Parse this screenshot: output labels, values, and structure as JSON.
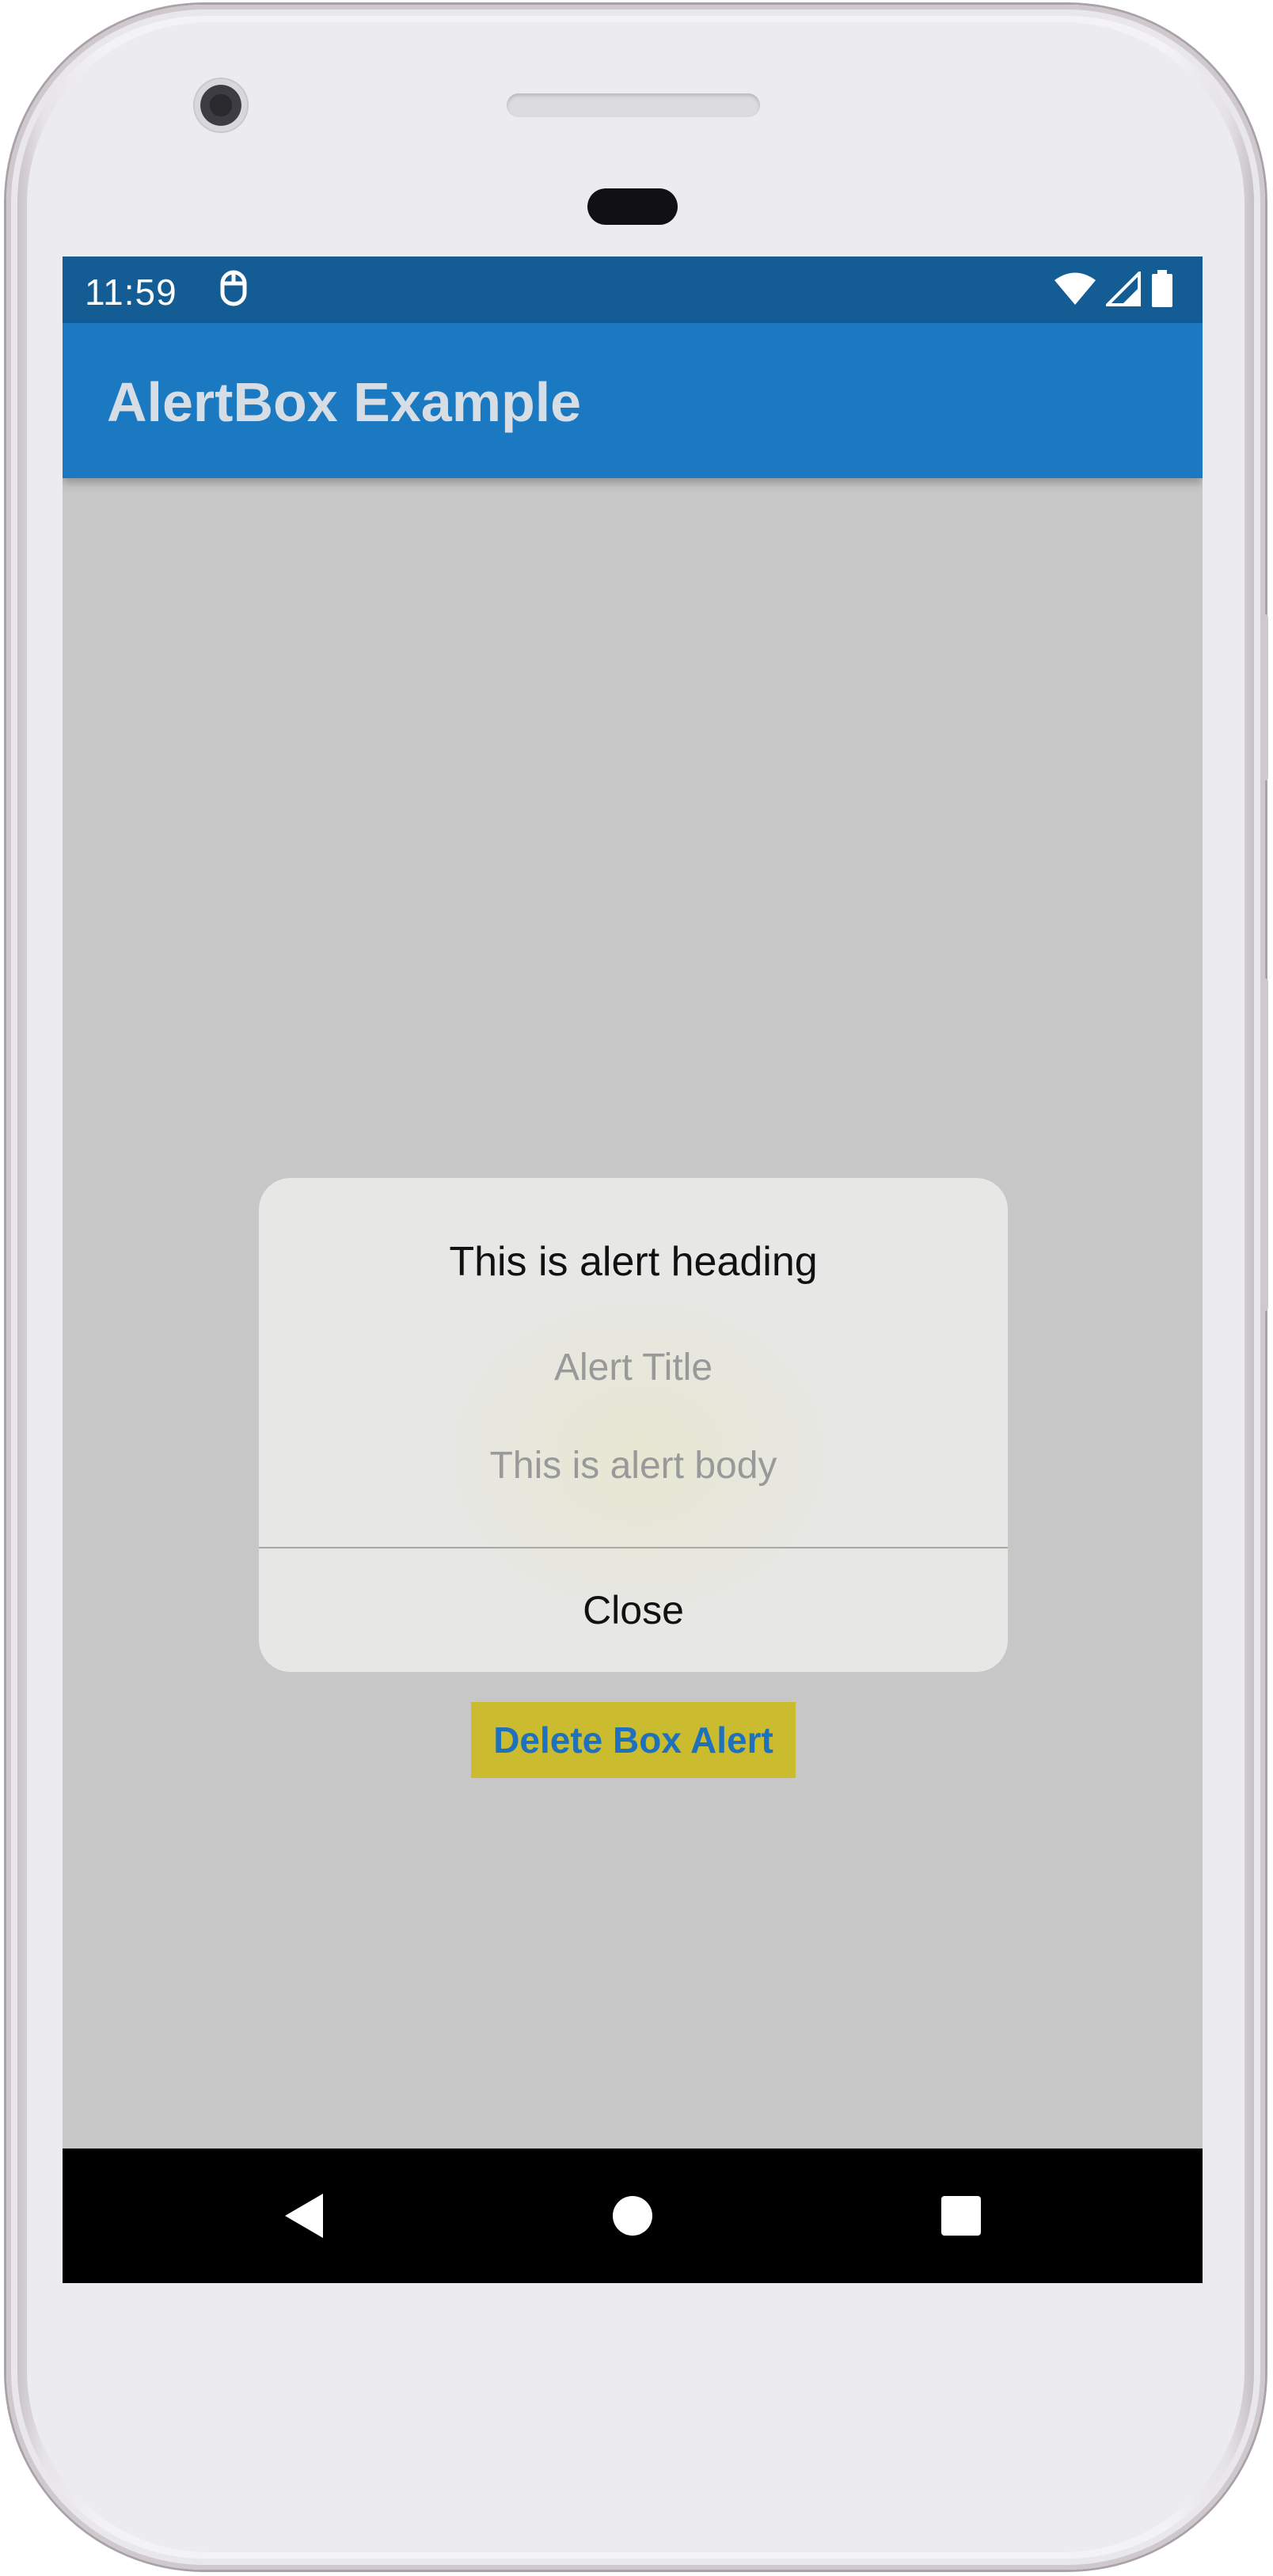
{
  "status_bar": {
    "time": "11:59",
    "icons": [
      "notification-app-icon",
      "wifi-icon",
      "signal-icon",
      "battery-icon"
    ]
  },
  "app_bar": {
    "title": "AlertBox Example"
  },
  "main": {
    "delete_button_label": "Delete Box Alert"
  },
  "dialog": {
    "heading": "This is alert heading",
    "title": "Alert Title",
    "body": "This is alert body",
    "close_label": "Close"
  },
  "nav_bar": {
    "icons": [
      "back-icon",
      "home-icon",
      "recents-icon"
    ]
  },
  "colors": {
    "status_bar": "#135c94",
    "app_bar": "#1b79c2",
    "screen_background": "#c7c7c7",
    "button_background": "#cbbb2e",
    "button_text": "#1e72bd",
    "dialog_background": "#e7e7e6"
  }
}
